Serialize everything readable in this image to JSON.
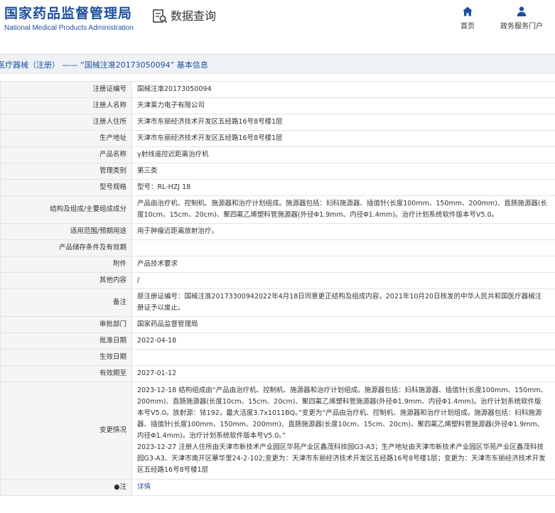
{
  "header": {
    "logo_cn": "国家药品监督管理局",
    "logo_en": "National Medical Products Administration",
    "search_label": "数据查询",
    "nav": [
      {
        "label": "首页",
        "icon": "home-icon"
      },
      {
        "label": "政务服务门户",
        "icon": "user-icon"
      }
    ]
  },
  "breadcrumb": "医疗器械（注册） —— “国械注准20173050094” 基本信息",
  "rows": [
    {
      "label": "注册证编号",
      "value": "国械注准20173050094"
    },
    {
      "label": "注册人名称",
      "value": "天津莱力电子有限公司"
    },
    {
      "label": "注册人住所",
      "value": "天津市东丽经济技术开发区五经路16号8号楼1层"
    },
    {
      "label": "生产地址",
      "value": "天津市东丽经济技术开发区五经路16号8号楼1层"
    },
    {
      "label": "产品名称",
      "value": "γ射线遥控近距离治疗机"
    },
    {
      "label": "管理类别",
      "value": "第三类"
    },
    {
      "label": "型号规格",
      "value": "型号：RL-HZJ 18"
    },
    {
      "label": "结构及组成/主要组成成分",
      "value": "产品由治疗机、控制机、施源器和治疗计划组成。施源器包括：妇科施源器、插值针(长度100mm、150mm、200mm)、直肠施源器(长度10cm、15cm、20cm)、聚四氟乙烯塑料管施源器(外径Φ1.9mm、内径Φ1.4mm)。治疗计划系统软件版本号V5.0。"
    },
    {
      "label": "适用范围/预期用途",
      "value": "用于肿瘤近距离放射治疗。"
    },
    {
      "label": "产品储存条件及有效期",
      "value": ""
    },
    {
      "label": "附件",
      "value": "产品技术要求"
    },
    {
      "label": "其他内容",
      "value": "/"
    },
    {
      "label": "备注",
      "value": "原注册证编号：国械注准20173300942022年4月18日同意更正结构及组成内容，2021年10月20日核发的中华人民共和国医疗器械注册证予以废止。"
    },
    {
      "label": "审批部门",
      "value": "国家药品监督管理局"
    },
    {
      "label": "批准日期",
      "value": "2022-04-18"
    },
    {
      "label": "生效日期",
      "value": ""
    },
    {
      "label": "有效期至",
      "value": "2027-01-12"
    },
    {
      "label": "变更情况",
      "value": "2023-12-18 结构组成由“产品由治疗机、控制机、施源器和治疗计划组成。施源器包括：妇科施源器、插值针(长度100mm、150mm、200mm)、直肠施源器(长度10cm、15cm、20cm)、聚四氟乙烯塑料管施源器(外径Φ1.9mm、内径Φ1.4mm)。治疗计划系统软件版本号V5.0。放射源：铱192，最大活度3.7x1011BQ。”变更为“产品由治疗机、控制机、施源器和治疗计划组成。施源器包括：妇科施源器、插值针(长度100mm、150mm、200mm)、直肠施源器(长度10cm、15cm、20cm)、聚四氟乙烯塑料管施源器(外径Φ1.9mm、内径Φ1.4mm)。治疗计划系统软件版本号V5.0。”\n2023-12-27 注册人住所由天津市新技术产业园区华苑产业区鑫茂科技园G3-A3；生产地址由天津市新技术产业园区华苑产业区鑫茂科技园G3-A3、天津市南开区華华里24-2-102;变更为：天津市东丽经济技术开发区五经路16号8号楼1层；变更为：天津市东丽经济技术开发区五经路16号8号楼1层"
    },
    {
      "label": "●注",
      "value": "详情"
    }
  ],
  "colors": {
    "brand_blue": "#1d4f9f",
    "label_bg": "#f5f5f5",
    "breadcrumb_bg": "#eef1f5"
  }
}
